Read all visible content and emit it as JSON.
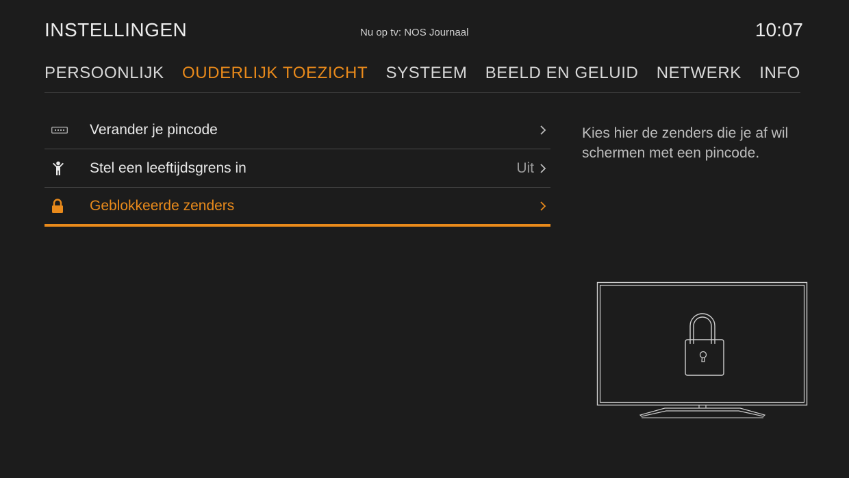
{
  "header": {
    "title": "INSTELLINGEN",
    "now_playing": "Nu op tv: NOS Journaal",
    "clock": "10:07"
  },
  "tabs": [
    {
      "label": "PERSOONLIJK",
      "active": false
    },
    {
      "label": "OUDERLIJK TOEZICHT",
      "active": true
    },
    {
      "label": "SYSTEEM",
      "active": false
    },
    {
      "label": "BEELD EN GELUID",
      "active": false
    },
    {
      "label": "NETWERK",
      "active": false
    },
    {
      "label": "INFO",
      "active": false
    }
  ],
  "menu": {
    "items": [
      {
        "label": "Verander je pincode",
        "icon": "pincode-icon",
        "value": ""
      },
      {
        "label": "Stel een leeftijdsgrens in",
        "icon": "child-icon",
        "value": "Uit"
      },
      {
        "label": "Geblokkeerde zenders",
        "icon": "lock-icon",
        "value": "",
        "active": true
      }
    ]
  },
  "description": "Kies hier de zenders die je af wil schermen met een pincode.",
  "illustration": {
    "icon": "tv-lock-icon"
  },
  "colors": {
    "background": "#1c1c1c",
    "accent": "#e98a1b",
    "text": "#e6e6e6",
    "muted": "#9a9a9a",
    "divider": "#4a4a4a"
  }
}
